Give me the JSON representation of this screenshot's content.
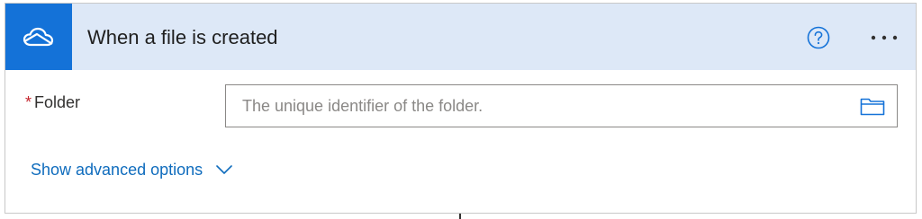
{
  "trigger": {
    "title": "When a file is created",
    "icon": "onedrive-cloud-icon",
    "header_color": "#dde8f7",
    "icon_tile_color": "#1472d8",
    "help_icon": "question-circle-icon",
    "more_icon": "ellipsis-icon"
  },
  "fields": {
    "folder": {
      "required_marker": "*",
      "label": "Folder",
      "value": "",
      "placeholder": "The unique identifier of the folder.",
      "picker_icon": "folder-icon"
    }
  },
  "advanced": {
    "label": "Show advanced options",
    "icon": "chevron-down-icon",
    "link_color": "#0f6cbd"
  }
}
